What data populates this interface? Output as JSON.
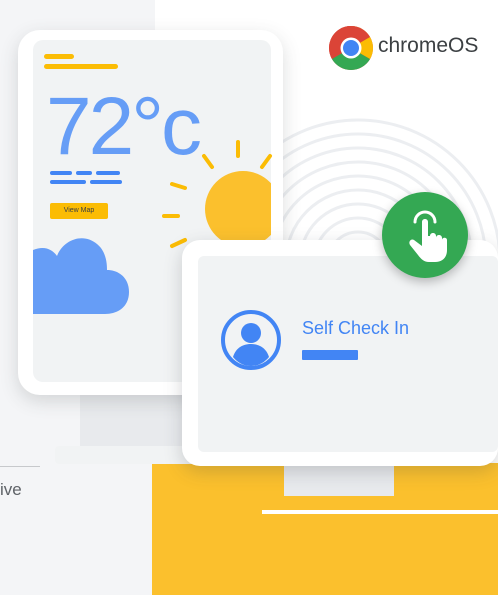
{
  "brand": {
    "logo_icon": "chrome-logo-icon",
    "name": "chromeOS"
  },
  "weather_screen": {
    "temperature": "72°c",
    "button_label": "View Map",
    "icons": [
      "sun-icon",
      "cloud-icon"
    ]
  },
  "kiosk_screen": {
    "label": "Self Check In",
    "avatar_icon": "user-avatar-icon",
    "touch_icon": "tap-hand-icon"
  },
  "partial_text": "ive",
  "colors": {
    "accent_blue": "#4285f4",
    "light_blue": "#669df6",
    "yellow": "#fbbc04",
    "block_yellow": "#fbc02d",
    "green": "#34a853",
    "text": "#3c4043"
  }
}
